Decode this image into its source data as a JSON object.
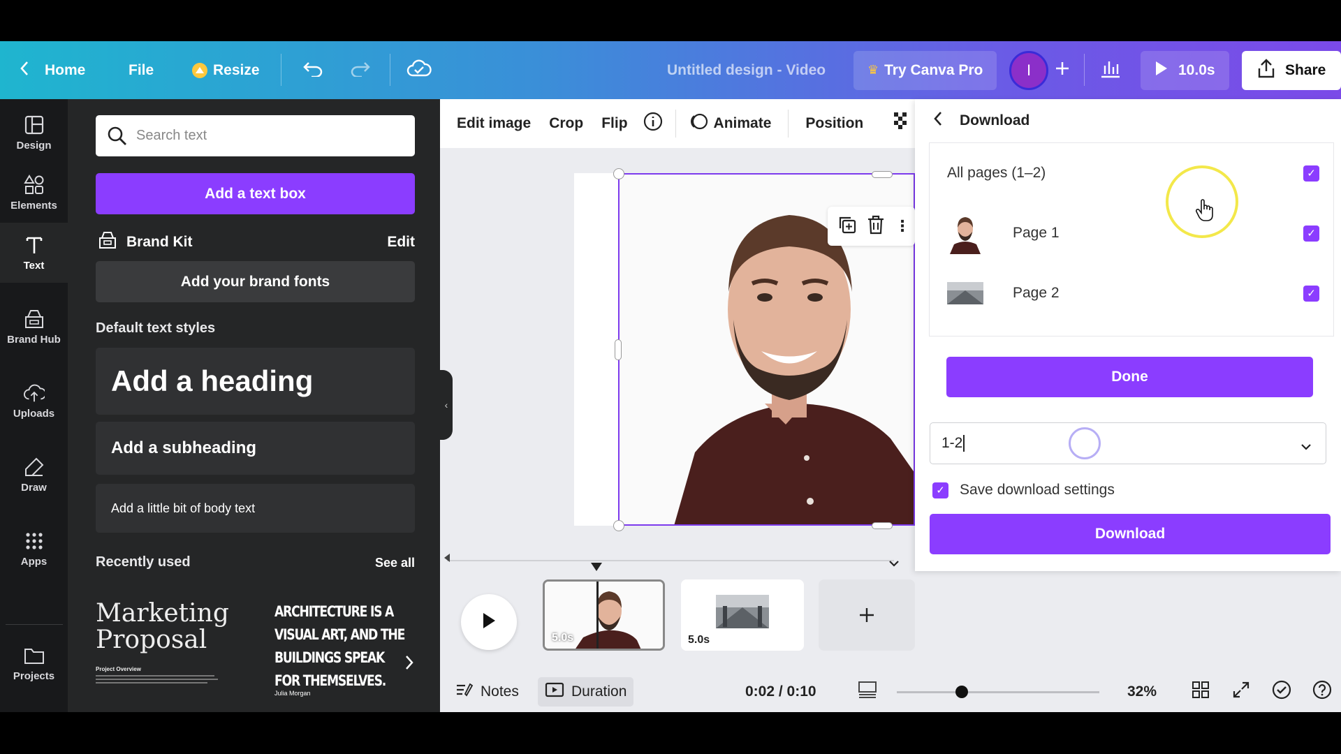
{
  "topbar": {
    "home": "Home",
    "file": "File",
    "resize": "Resize",
    "title": "Untitled design - Video",
    "try_pro": "Try Canva Pro",
    "avatar_letter": "I",
    "play_duration": "10.0s",
    "share": "Share"
  },
  "rail": {
    "items": [
      {
        "label": "Design",
        "icon": "layout-icon"
      },
      {
        "label": "Elements",
        "icon": "shapes-icon"
      },
      {
        "label": "Text",
        "icon": "text-icon"
      },
      {
        "label": "Brand Hub",
        "icon": "brand-icon"
      },
      {
        "label": "Uploads",
        "icon": "upload-icon"
      },
      {
        "label": "Draw",
        "icon": "draw-icon"
      },
      {
        "label": "Apps",
        "icon": "apps-icon"
      },
      {
        "label": "Projects",
        "icon": "folder-icon"
      }
    ]
  },
  "panel": {
    "search_placeholder": "Search text",
    "add_text_box": "Add a text box",
    "brand_kit": "Brand Kit",
    "brand_kit_edit": "Edit",
    "add_brand_fonts": "Add your brand fonts",
    "default_styles_label": "Default text styles",
    "heading": "Add a heading",
    "subheading": "Add a subheading",
    "body": "Add a little bit of body text",
    "recently_used": "Recently used",
    "see_all": "See all",
    "recent1_title": "Marketing Proposal",
    "recent1_sub": "Project Overview",
    "recent2_text": "ARCHITECTURE IS A VISUAL ART, AND THE BUILDINGS SPEAK FOR THEMSELVES.",
    "recent2_author": "Julia Morgan"
  },
  "toolbar": {
    "edit_image": "Edit image",
    "crop": "Crop",
    "flip": "Flip",
    "animate": "Animate",
    "position": "Position"
  },
  "timeline": {
    "clips": [
      {
        "duration": "5.0s"
      },
      {
        "duration": "5.0s"
      }
    ]
  },
  "status": {
    "notes": "Notes",
    "duration": "Duration",
    "time": "0:02 / 0:10",
    "zoom": "32%",
    "zoom_level": 0.32
  },
  "download": {
    "back_title": "Download",
    "all_pages": "All pages (1–2)",
    "pages": [
      {
        "label": "Page 1",
        "checked": true
      },
      {
        "label": "Page 2",
        "checked": true
      }
    ],
    "done": "Done",
    "range_value": "1-2",
    "save_settings": "Save download settings",
    "download": "Download"
  },
  "colors": {
    "accent": "#8b3dff",
    "panel_dark": "#252627",
    "rail_dark": "#18191b"
  }
}
